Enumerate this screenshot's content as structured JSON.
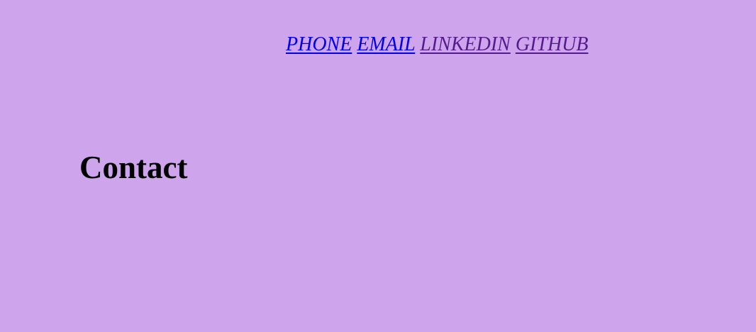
{
  "nav": {
    "links": [
      {
        "label": "PHONE",
        "state": "unvisited",
        "color": "#0000ee"
      },
      {
        "label": "EMAIL",
        "state": "unvisited",
        "color": "#0000ee"
      },
      {
        "label": "LINKEDIN",
        "state": "visited",
        "color": "#551a8b"
      },
      {
        "label": "GITHUB",
        "state": "visited",
        "color": "#551a8b"
      }
    ]
  },
  "page": {
    "title": "Contact",
    "background_color": "#cea4ed"
  }
}
